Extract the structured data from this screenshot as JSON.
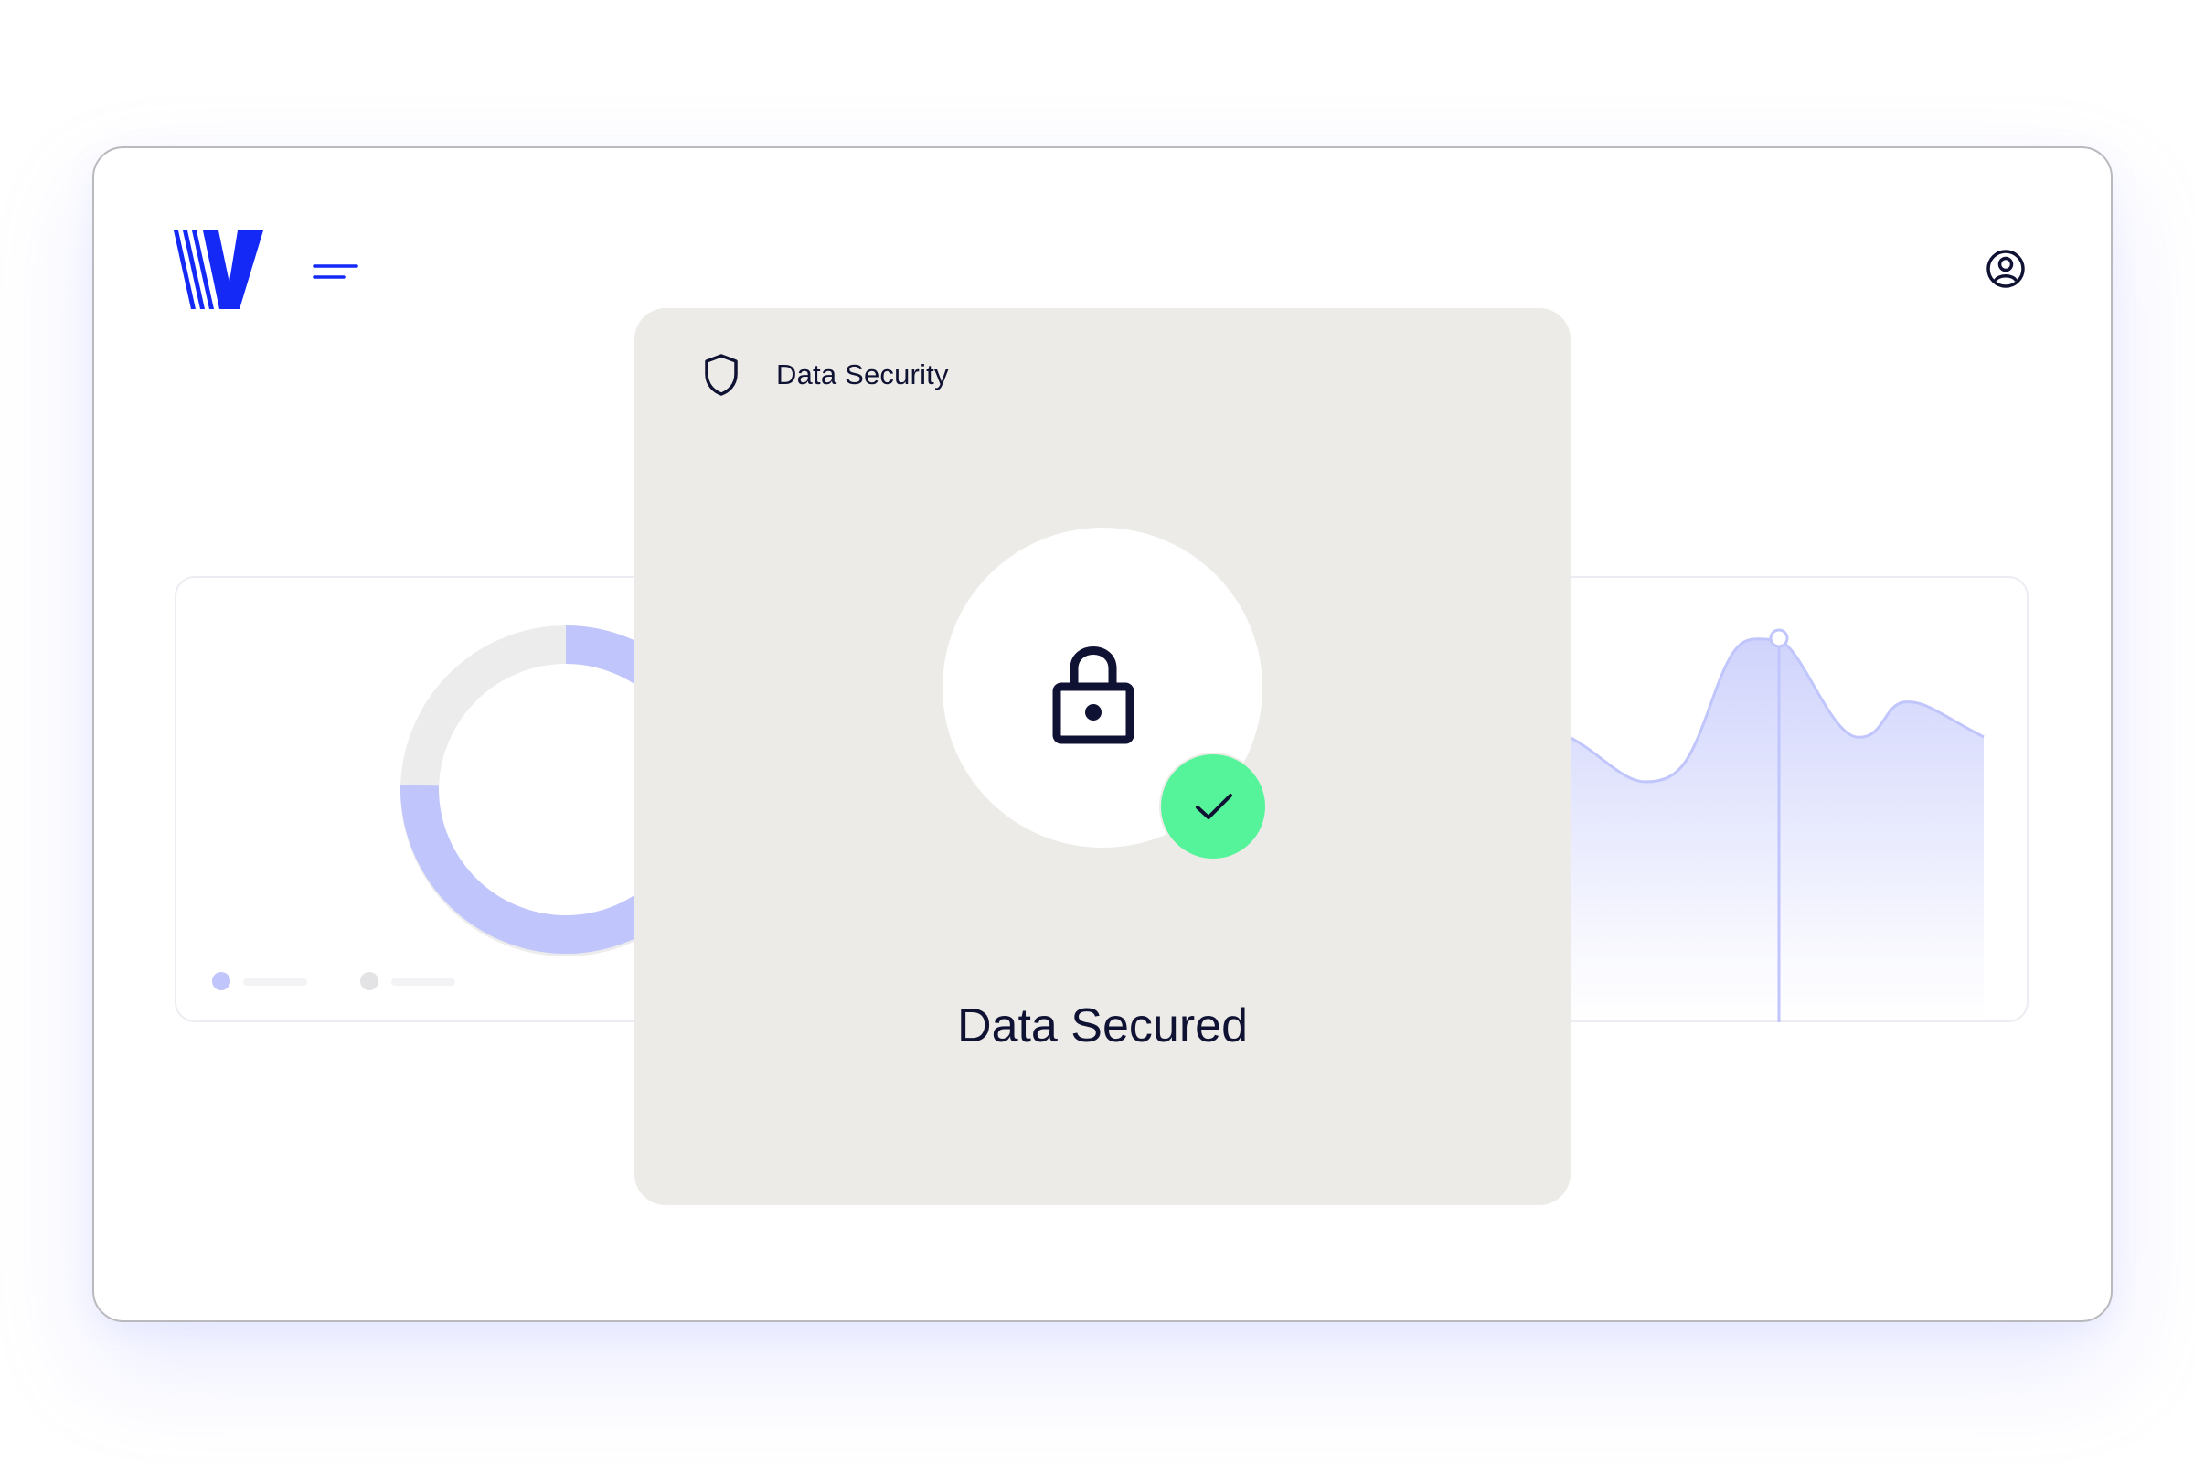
{
  "brand": {
    "logo_icon": "v-logo-icon",
    "color": "#1429f5"
  },
  "header": {
    "menu_icon": "menu-icon",
    "user_icon": "user-circle-icon"
  },
  "dashboard": {
    "donut_color": "#c0c5fb",
    "donut_track_color": "#ececec",
    "wave_color": "#c0c5fb",
    "legend_dot_colors": [
      "#c0c5fb",
      "#e3e3e6"
    ]
  },
  "card": {
    "header_icon": "shield-icon",
    "title": "Data Security",
    "lock_icon": "lock-icon",
    "check_icon": "check-icon",
    "check_color": "#55f49b",
    "status": "Data Secured"
  },
  "colors": {
    "ink": "#101233",
    "card_bg": "#ecebe7"
  }
}
